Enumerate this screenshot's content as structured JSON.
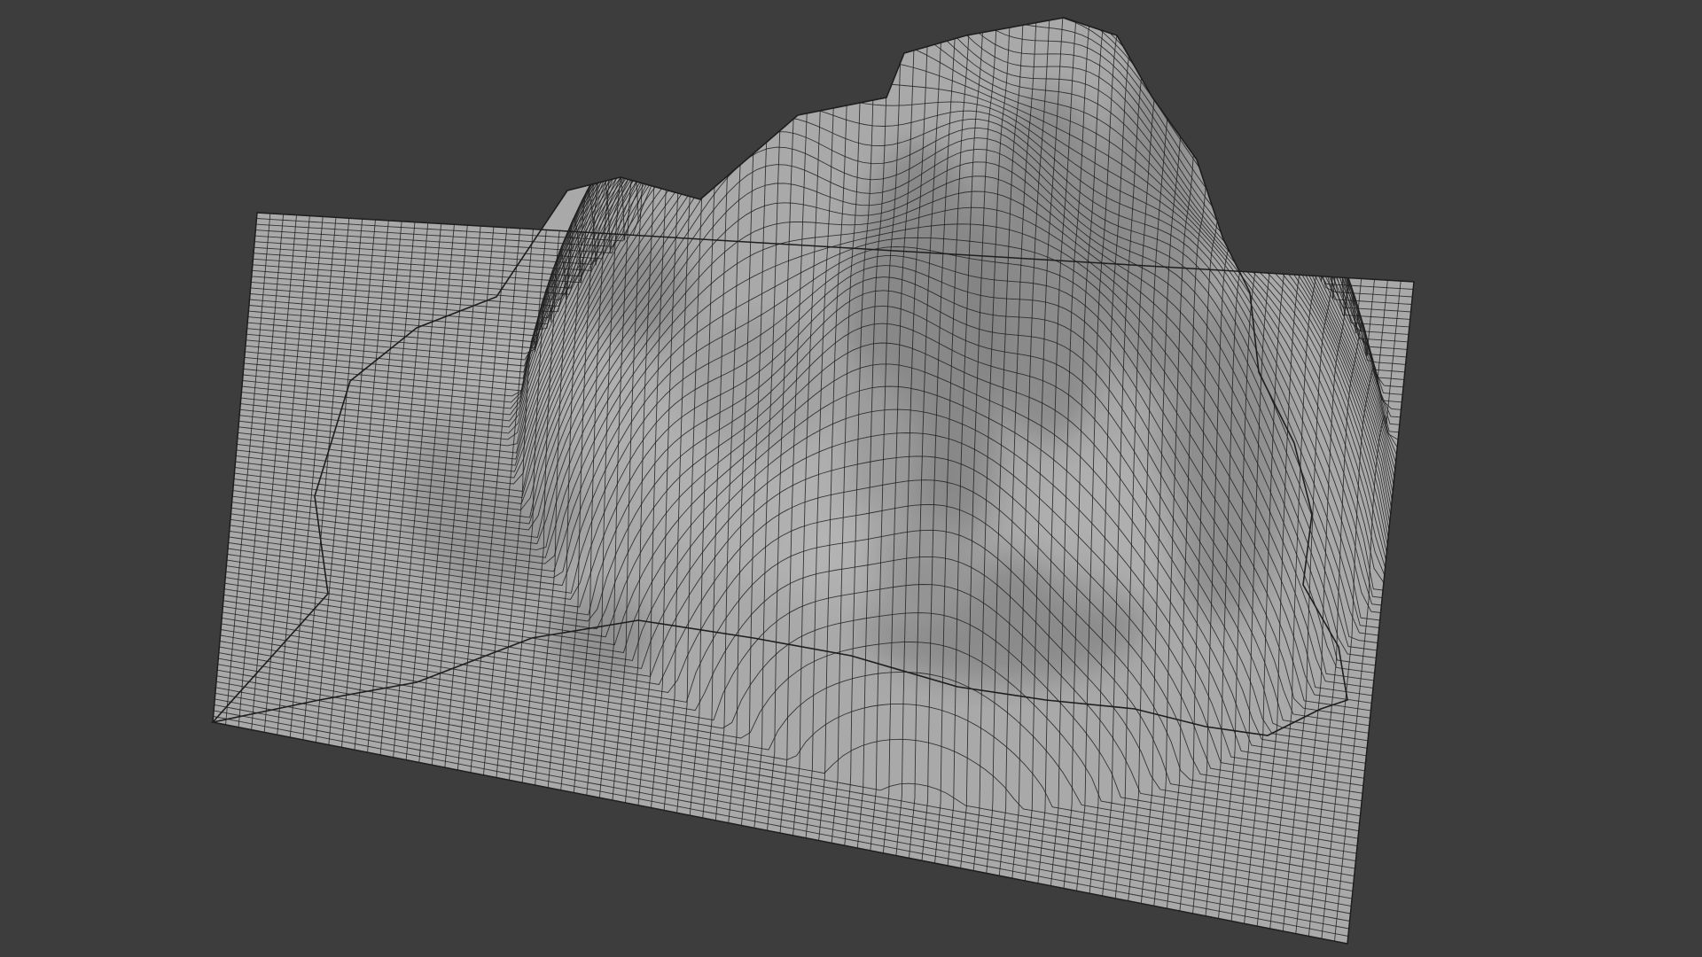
{
  "viewport": {
    "background_color": "#3d3d3d",
    "content": "wireframe-terrain-mesh",
    "mesh": {
      "surface_color": "#a9a9a9",
      "wire_color": "#1e1e1e",
      "shadow_color": "#6e6e6e",
      "highlight_color": "#bdbdbd",
      "topology": "quad-grid"
    }
  }
}
